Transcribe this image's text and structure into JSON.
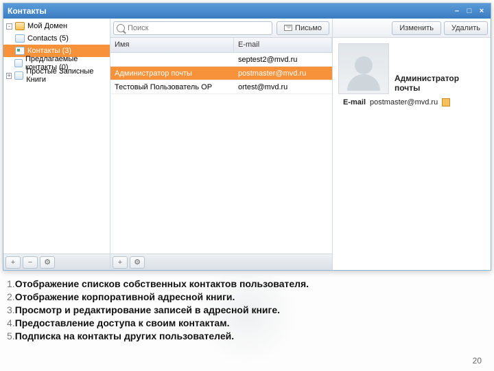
{
  "window": {
    "title": "Контакты"
  },
  "sidebar": {
    "items": [
      {
        "label": "Мой Домен",
        "expander": "-",
        "icon": "domain"
      },
      {
        "label": "Contacts (5)",
        "expander": "",
        "icon": "open"
      },
      {
        "label": "Контакты (3)",
        "expander": "",
        "icon": "card",
        "selected": true
      },
      {
        "label": "Предлагаемые контакты (0)",
        "expander": "",
        "icon": "open"
      },
      {
        "label": "Простые Записные Книги",
        "expander": "+",
        "icon": "open"
      }
    ]
  },
  "toolbar": {
    "search_placeholder": "Поиск",
    "write_label": "Письмо",
    "edit_label": "Изменить",
    "delete_label": "Удалить"
  },
  "table": {
    "col_name": "Имя",
    "col_mail": "E-mail",
    "rows": [
      {
        "name": "",
        "mail": "septest2@mvd.ru",
        "selected": false
      },
      {
        "name": "Администратор почты",
        "mail": "postmaster@mvd.ru",
        "selected": true
      },
      {
        "name": "Тестовый Пользователь ОР",
        "mail": "ortest@mvd.ru",
        "selected": false
      }
    ]
  },
  "detail": {
    "name": "Администратор почты",
    "mail_label": "E-mail",
    "mail": "postmaster@mvd.ru"
  },
  "notes": {
    "n1": "1.",
    "t1": "Отображение списков собственных контактов пользователя.",
    "n2": "2.",
    "t2": "Отображение корпоративной адресной книги.",
    "n3": "3.",
    "t3": "Просмотр и редактирование записей в адресной книге.",
    "n4": "4.",
    "t4": "Предоставление доступа к своим контактам.",
    "n5": "5.",
    "t5": "Подписка на контакты других пользователей."
  },
  "page_number": "20",
  "glyph": {
    "plus": "+",
    "minus": "−",
    "gear": "⚙",
    "min_w": "–",
    "max_w": "□",
    "close_w": "×"
  }
}
